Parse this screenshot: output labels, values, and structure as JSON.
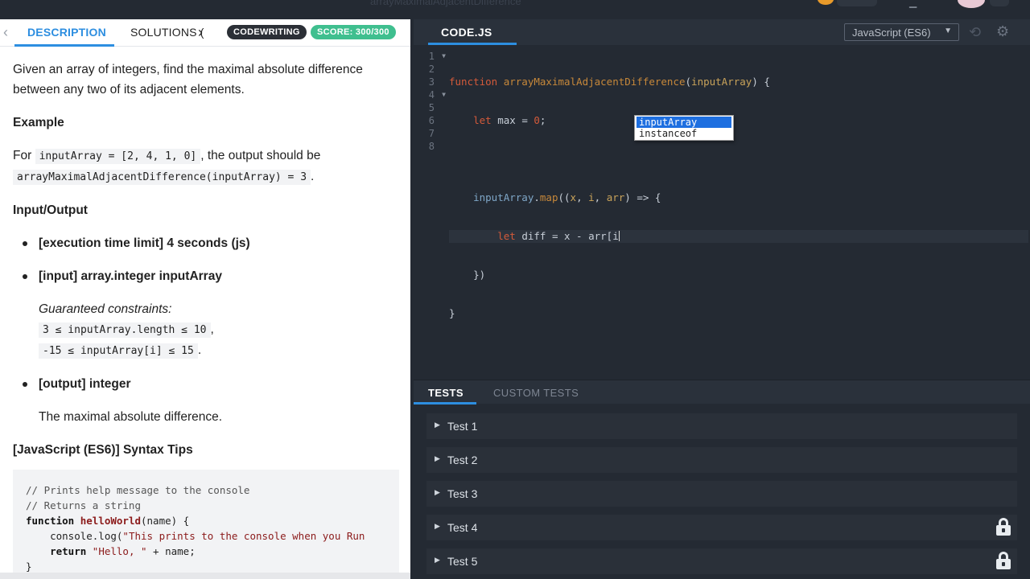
{
  "topbar": {
    "title": "arrayMaximalAdjacentDifference"
  },
  "left": {
    "tabs": {
      "description": "DESCRIPTION",
      "solutions": "SOLUTIONS (",
      "badge_codewriting": "CODEWRITING",
      "badge_score": "SCORE: 300/300"
    },
    "intro": "Given an array of integers, find the maximal absolute difference between any two of its adjacent elements.",
    "example_heading": "Example",
    "example_for": "For",
    "example_input": "inputArray = [2, 4, 1, 0]",
    "example_mid": ", the output should be",
    "example_output": "arrayMaximalAdjacentDifference(inputArray) = 3",
    "example_end": ".",
    "io_heading": "Input/Output",
    "time_limit": "[execution time limit] 4 seconds (js)",
    "input_label": "[input] array.integer inputArray",
    "constraints_heading": "Guaranteed constraints:",
    "constraint1": "3 ≤ inputArray.length ≤ 10",
    "constraint1_end": ",",
    "constraint2": "-15 ≤ inputArray[i] ≤ 15",
    "constraint2_end": ".",
    "output_label": "[output] integer",
    "output_desc": "The maximal absolute difference.",
    "tips_heading": "[JavaScript (ES6)] Syntax Tips",
    "tips_code": {
      "line1": "// Prints help message to the console",
      "line2": "// Returns a string",
      "line3_kw": "function ",
      "line3_fn": "helloWorld",
      "line3_rest": "(name) {",
      "line4_pre": "    console.log(",
      "line4_str": "\"This prints to the console when you Run",
      "line5_kw": "    return ",
      "line5_str": "\"Hello, \"",
      "line5_rest": " + name;",
      "line6": "}"
    }
  },
  "editor": {
    "tab": "CODE.JS",
    "language": "JavaScript (ES6)",
    "line_numbers": [
      "1",
      "2",
      "3",
      "4",
      "5",
      "6",
      "7",
      "8"
    ],
    "code": {
      "l1_kw": "function ",
      "l1_fn": "arrayMaximalAdjacentDifference",
      "l1_p1": "(",
      "l1_arg": "inputArray",
      "l1_p2": ") {",
      "l2_kw": "    let ",
      "l2_var": "max",
      "l2_rest": " = ",
      "l2_num": "0",
      "l2_end": ";",
      "l4_obj": "    inputArray",
      "l4_dot": ".",
      "l4_m": "map",
      "l4_p1": "((",
      "l4_a1": "x",
      "l4_c1": ", ",
      "l4_a2": "i",
      "l4_c2": ", ",
      "l4_a3": "arr",
      "l4_end": ") => {",
      "l5_kw": "        let ",
      "l5_var": "diff",
      "l5_rest": " = x - arr[i",
      "l6": "    })",
      "l7": "}"
    },
    "autocomplete": [
      "inputArray",
      "instanceof"
    ]
  },
  "tests": {
    "tab_tests": "TESTS",
    "tab_custom": "CUSTOM TESTS",
    "items": [
      "Test 1",
      "Test 2",
      "Test 3",
      "Test 4",
      "Test 5"
    ]
  }
}
